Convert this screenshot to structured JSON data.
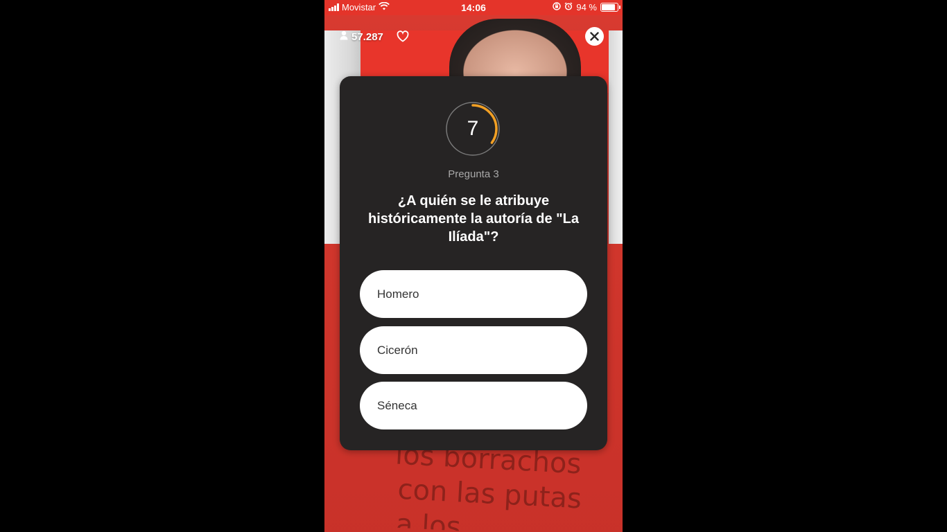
{
  "status_bar": {
    "carrier": "Movistar",
    "time": "14:06",
    "battery_percent": "94 %",
    "battery_level": 0.94,
    "icons": [
      "signal-icon",
      "wifi-icon",
      "orientation-lock-icon",
      "alarm-icon",
      "battery-icon"
    ]
  },
  "overlay": {
    "viewer_count": "57.287",
    "icons": [
      "person-icon",
      "heart-icon",
      "close-icon"
    ]
  },
  "quiz": {
    "timer_value": "7",
    "timer_progress": 0.35,
    "question_label": "Pregunta 3",
    "question_text": "¿A quién se le atribuye históricamente la autoría de \"La Ilíada\"?",
    "answers": [
      {
        "label": "Homero"
      },
      {
        "label": "Cicerón"
      },
      {
        "label": "Séneca"
      }
    ]
  },
  "background": {
    "shirt_text": [
      "los borrachos",
      "con las putas",
      "a los ..."
    ]
  },
  "colors": {
    "status_bar": "#e4342a",
    "card": "#262424",
    "timer_ring": "#f2a024",
    "answer_bg": "#ffffff"
  }
}
